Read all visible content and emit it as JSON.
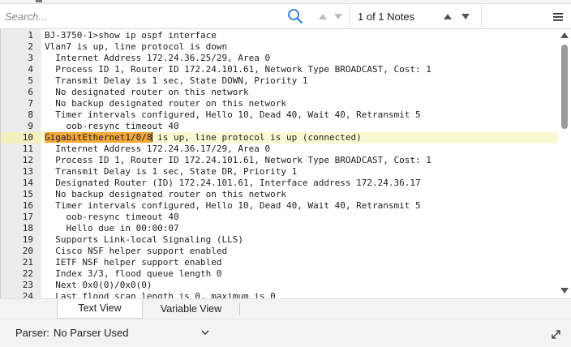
{
  "search": {
    "placeholder": "Search...",
    "value": "",
    "notes_count": "1 of 1 Notes"
  },
  "icons": {
    "search": "search-icon",
    "prev_result": "arrow-up-icon",
    "next_result": "arrow-down-icon",
    "prev_note": "arrow-up-icon",
    "next_note": "arrow-down-icon",
    "menu": "hamburger-menu-icon",
    "expand": "expand-icon",
    "dropdown": "chevron-down-icon"
  },
  "colors": {
    "highlight": "#f4a73a",
    "current_line": "#fafad2",
    "gutter": "#ececec",
    "search_icon": "#2a7bd4"
  },
  "editor": {
    "current_line": 10,
    "highlight_text": "GigabitEthernet1/0/8",
    "lines": [
      {
        "n": "1",
        "text": "BJ-3750-1>show ip ospf interface"
      },
      {
        "n": "2",
        "text": "Vlan7 is up, line protocol is down"
      },
      {
        "n": "3",
        "text": "  Internet Address 172.24.36.25/29, Area 0"
      },
      {
        "n": "4",
        "text": "  Process ID 1, Router ID 172.24.101.61, Network Type BROADCAST, Cost: 1"
      },
      {
        "n": "5",
        "text": "  Transmit Delay is 1 sec, State DOWN, Priority 1"
      },
      {
        "n": "6",
        "text": "  No designated router on this network"
      },
      {
        "n": "7",
        "text": "  No backup designated router on this network"
      },
      {
        "n": "8",
        "text": "  Timer intervals configured, Hello 10, Dead 40, Wait 40, Retransmit 5"
      },
      {
        "n": "9",
        "text": "    oob-resync timeout 40"
      },
      {
        "n": "10",
        "text": " is up, line protocol is up (connected)"
      },
      {
        "n": "11",
        "text": "  Internet Address 172.24.36.17/29, Area 0"
      },
      {
        "n": "12",
        "text": "  Process ID 1, Router ID 172.24.101.61, Network Type BROADCAST, Cost: 1"
      },
      {
        "n": "13",
        "text": "  Transmit Delay is 1 sec, State DR, Priority 1"
      },
      {
        "n": "14",
        "text": "  Designated Router (ID) 172.24.101.61, Interface address 172.24.36.17"
      },
      {
        "n": "15",
        "text": "  No backup designated router on this network"
      },
      {
        "n": "16",
        "text": "  Timer intervals configured, Hello 10, Dead 40, Wait 40, Retransmit 5"
      },
      {
        "n": "17",
        "text": "    oob-resync timeout 40"
      },
      {
        "n": "18",
        "text": "    Hello due in 00:00:07"
      },
      {
        "n": "19",
        "text": "  Supports Link-local Signaling (LLS)"
      },
      {
        "n": "20",
        "text": "  Cisco NSF helper support enabled"
      },
      {
        "n": "21",
        "text": "  IETF NSF helper support enabled"
      },
      {
        "n": "22",
        "text": "  Index 3/3, flood queue length 0"
      },
      {
        "n": "23",
        "text": "  Next 0x0(0)/0x0(0)"
      },
      {
        "n": "24",
        "text": "  Last flood scan length is 0, maximum is 0"
      }
    ]
  },
  "tabs": [
    {
      "label": "Text View",
      "active": true
    },
    {
      "label": "Variable View",
      "active": false
    }
  ],
  "status": {
    "parser_label": "Parser:",
    "parser_value": "No Parser Used"
  }
}
